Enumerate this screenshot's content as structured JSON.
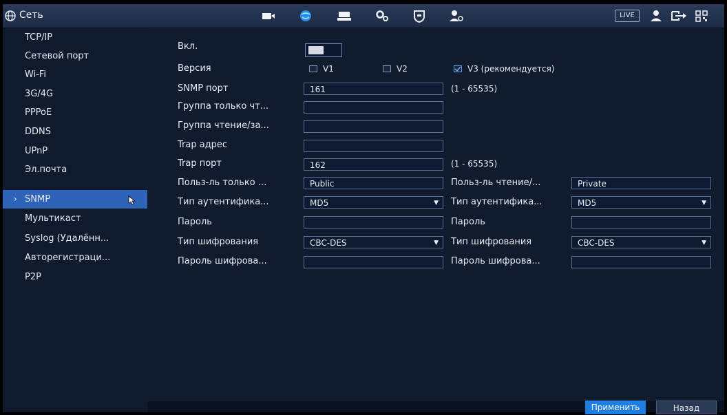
{
  "header": {
    "title": "Сеть",
    "live_label": "LIVE"
  },
  "sidebar": {
    "items": [
      {
        "label": "TCP/IP"
      },
      {
        "label": "Сетевой порт"
      },
      {
        "label": "Wi-Fi"
      },
      {
        "label": "3G/4G"
      },
      {
        "label": "PPPoE"
      },
      {
        "label": "DDNS"
      },
      {
        "label": "UPnP"
      },
      {
        "label": "Эл.почта"
      },
      {
        "label": "SNMP"
      },
      {
        "label": "Мультикаст"
      },
      {
        "label": "Syslog (Удалённ..."
      },
      {
        "label": "Авторегистраци..."
      },
      {
        "label": "P2P"
      }
    ],
    "active_index": 8
  },
  "form": {
    "enable_label": "Вкл.",
    "version_label": "Версия",
    "versions": [
      {
        "label": "V1",
        "checked": false
      },
      {
        "label": "V2",
        "checked": false
      },
      {
        "label": "V3 (рекомендуется)",
        "checked": true
      }
    ],
    "snmp_port_label": "SNMP порт",
    "snmp_port_value": "161",
    "snmp_port_hint": "(1 - 65535)",
    "read_group_label": "Группа только чт...",
    "rw_group_label": "Группа чтение/за...",
    "trap_addr_label": "Trap адрес",
    "trap_port_label": "Trap порт",
    "trap_port_value": "162",
    "trap_port_hint": "(1 - 65535)",
    "ro_user_label": "Польз-ль только ...",
    "ro_user_value": "Public",
    "rw_user_label": "Польз-ль чтение/...",
    "rw_user_value": "Private",
    "auth_type_label": "Тип аутентифика...",
    "auth_type_value": "MD5",
    "auth_type_label_r": "Тип аутентифика...",
    "auth_type_value_r": "MD5",
    "password_label": "Пароль",
    "password_label_r": "Пароль",
    "enc_type_label": "Тип шифрования",
    "enc_type_value": "CBC-DES",
    "enc_type_label_r": "Тип шифрования",
    "enc_type_value_r": "CBC-DES",
    "enc_pass_label": "Пароль шифрова...",
    "enc_pass_label_r": "Пароль шифрова..."
  },
  "buttons": {
    "apply": "Применить",
    "back": "Назад"
  }
}
